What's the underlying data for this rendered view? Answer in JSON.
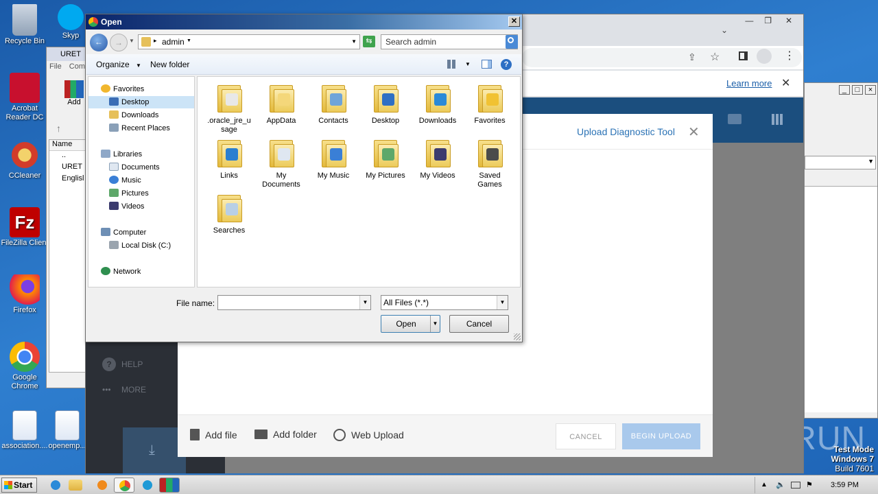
{
  "desktop": {
    "icons": [
      {
        "label": "Recycle Bin"
      },
      {
        "label": "Acrobat Reader DC"
      },
      {
        "label": "CCleaner"
      },
      {
        "label": "FileZilla Client"
      },
      {
        "label": "Firefox"
      },
      {
        "label": "Google Chrome"
      },
      {
        "label": "association...."
      },
      {
        "label": "openemp..."
      }
    ],
    "partial_labels": {
      "skype": "Skyp"
    },
    "watermark": "ANY RUN",
    "test_mode": {
      "line1": "Test Mode",
      "line2": "Windows 7",
      "line3": "Build 7601"
    }
  },
  "uret_window": {
    "title": "URET",
    "menu": [
      "File",
      "Com"
    ],
    "add_label": "Add",
    "col_name": "Name",
    "rows": [
      "..",
      "URET",
      "Englisl"
    ]
  },
  "chrome": {
    "infobar_link": "Learn more",
    "sidebar_items": [
      "HELP",
      "MORE"
    ],
    "modal": {
      "title": "Upload Diagnostic Tool",
      "add_file": "Add file",
      "add_folder": "Add folder",
      "web_upload": "Web Upload",
      "cancel": "CANCEL",
      "begin_upload": "BEGIN UPLOAD"
    }
  },
  "dialog": {
    "title": "Open",
    "address": {
      "current": "admin"
    },
    "search_placeholder": "Search admin",
    "toolbar": {
      "organize": "Organize",
      "new_folder": "New folder"
    },
    "nav": {
      "favorites": "Favorites",
      "favorites_items": [
        "Desktop",
        "Downloads",
        "Recent Places"
      ],
      "libraries": "Libraries",
      "libraries_items": [
        "Documents",
        "Music",
        "Pictures",
        "Videos"
      ],
      "computer": "Computer",
      "computer_items": [
        "Local Disk (C:)"
      ],
      "network": "Network"
    },
    "folders": [
      {
        "name": ".oracle_jre_u sage",
        "badge": "#e8e8e8"
      },
      {
        "name": "AppData",
        "badge": "#f4d77a"
      },
      {
        "name": "Contacts",
        "badge": "#6fa4d9"
      },
      {
        "name": "Desktop",
        "badge": "#2f6fc4"
      },
      {
        "name": "Downloads",
        "badge": "#2b8ad8"
      },
      {
        "name": "Favorites",
        "badge": "#f1c232"
      },
      {
        "name": "Links",
        "badge": "#2b7fd0"
      },
      {
        "name": "My Documents",
        "badge": "#dfe7f1"
      },
      {
        "name": "My Music",
        "badge": "#3a7fd6"
      },
      {
        "name": "My Pictures",
        "badge": "#5ea86a"
      },
      {
        "name": "My Videos",
        "badge": "#3b3b6e"
      },
      {
        "name": "Saved Games",
        "badge": "#4b4b4b"
      },
      {
        "name": "Searches",
        "badge": "#b8cfe6"
      }
    ],
    "file_name_label": "File name:",
    "file_name_value": "",
    "file_type": "All Files (*.*)",
    "open_button": "Open",
    "cancel_button": "Cancel"
  },
  "taskbar": {
    "start": "Start",
    "clock": "3:59 PM"
  }
}
